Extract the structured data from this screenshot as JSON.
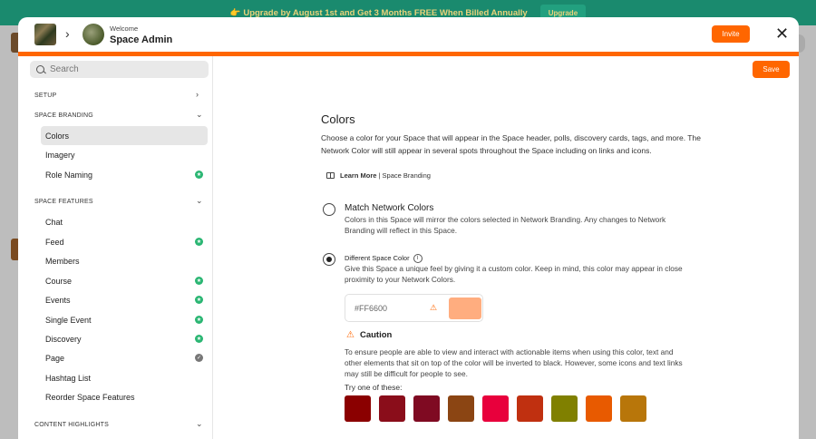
{
  "banner": {
    "text": "👉 Upgrade by August 1st and Get 3 Months FREE When Billed Annually",
    "button": "Upgrade"
  },
  "header": {
    "welcome": "Welcome",
    "name": "Space Admin",
    "invite": "Invite",
    "close": "✕"
  },
  "sidebar": {
    "search_placeholder": "Search",
    "sections": {
      "setup": "SETUP",
      "branding": "SPACE BRANDING",
      "features": "SPACE FEATURES",
      "highlights": "CONTENT HIGHLIGHTS"
    },
    "branding_items": [
      "Colors",
      "Imagery",
      "Role Naming"
    ],
    "feature_items": [
      "Chat",
      "Feed",
      "Members",
      "Course",
      "Events",
      "Single Event",
      "Discovery",
      "Page",
      "Hashtag List",
      "Reorder Space Features"
    ]
  },
  "main": {
    "save": "Save",
    "title": "Colors",
    "description": "Choose a color for your Space that will appear in the Space header, polls, discovery cards, tags, and more. The Network Color will still appear in several spots throughout the Space including on links and icons.",
    "learn_more": "Learn More",
    "learn_more_suffix": " | Space Branding",
    "option1_title": "Match Network Colors",
    "option1_desc": "Colors in this Space will mirror the colors selected in Network Branding. Any changes to Network Branding will reflect in this Space.",
    "option2_title": "Different Space Color",
    "option2_desc": "Give this Space a unique feel by giving it a custom color. Keep in mind, this color may appear in close proximity to your Network Colors.",
    "hex_value": "#FF6600",
    "caution_title": "Caution",
    "caution_text": "To ensure people are able to view and interact with actionable items when using this color, text and other elements that sit on top of the color will be inverted to black. However, some icons and text links may still be difficult for people to see.",
    "try_label": "Try one of these:",
    "swatch_colors": [
      "#8b0000",
      "#8a0d1a",
      "#7f0a22",
      "#8b4513",
      "#e8003c",
      "#c03010",
      "#808000",
      "#e85a00",
      "#b8760a"
    ]
  },
  "colors": {
    "accent": "#ff6600",
    "banner": "#1a8a6e",
    "badge_green": "#2bb673"
  }
}
